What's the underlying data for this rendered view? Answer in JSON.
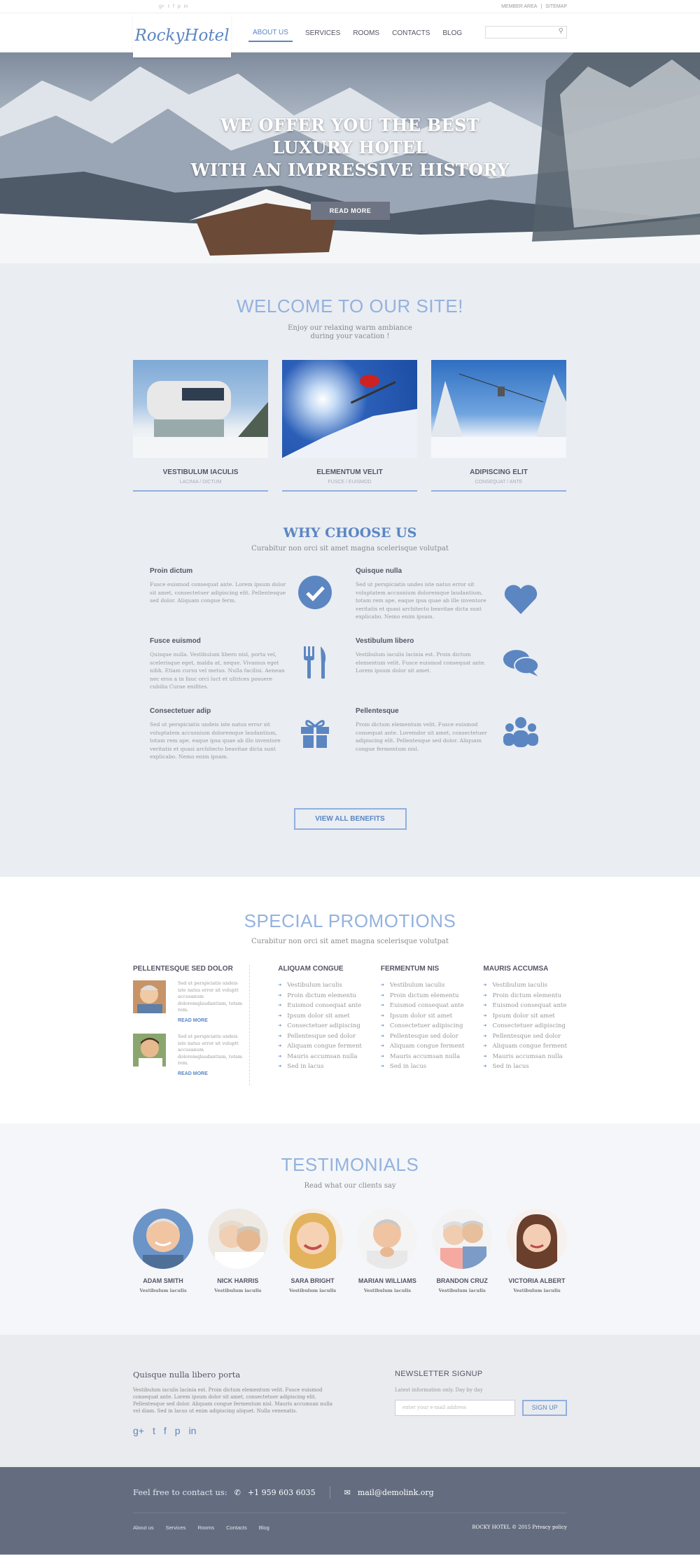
{
  "topbar": {
    "socials": [
      "g+",
      "t",
      "f",
      "p",
      "in"
    ],
    "links": [
      "MEMBER AREA",
      "|",
      "SITEMAP"
    ]
  },
  "header": {
    "logo": "RockyHotel",
    "nav": [
      "ABOUT US",
      "SERVICES",
      "ROOMS",
      "CONTACTS",
      "BLOG"
    ],
    "search_placeholder": "",
    "search_icon": "search-icon"
  },
  "hero": {
    "line1": "WE OFFER YOU THE BEST",
    "line2": "LUXURY HOTEL",
    "line3": "WITH AN IMPRESSIVE HISTORY",
    "button": "READ MORE"
  },
  "welcome": {
    "title": "WELCOME TO OUR SITE!",
    "sub1": "Enjoy our relaxing warm ambiance",
    "sub2": "during your vacation !",
    "cards": [
      {
        "title": "VESTIBULUM IACULIS",
        "sub": "LACINIA / DICTUM"
      },
      {
        "title": "ELEMENTUM VELIT",
        "sub": "FUSCE / EUISMOD"
      },
      {
        "title": "ADIPISCING ELIT",
        "sub": "CONSEQUAT / ANTE"
      }
    ]
  },
  "why": {
    "title": "WHY CHOOSE US",
    "sub": "Curabitur non orci sit amet magna scelerisque volutpat",
    "items": [
      {
        "title": "Proin dictum",
        "text": "Fusce euismod consequat ante. Lorem ipsum dolor sit amet, consectetuer adipiscing elit. Pellentesque sed dolor. Aliquam congue ferm.",
        "icon": "check-icon"
      },
      {
        "title": "Quisque nulla",
        "text": "Sed ut perspiciatis undes iste natus error sit voluptatem accusnium doloremque laudantium, totam rem ape, eaque ipsa quae ab ille inventore veritatis et quasi architecto beavitae dicta sunt explicabo. Nemo enim ipsam.",
        "icon": "heart-icon"
      },
      {
        "title": "Fusce euismod",
        "text": "Quisque nulla. Vestibulum libero nisl, porta vel, scelerisque eget, malda at, neque. Vivamus eget nibh. Etiam cursu vel metus. Nulla facilisi. Aenean nec eros a in fauc orci luct et ultrices posuere cubilia Curae enifites.",
        "icon": "fork-knife-icon"
      },
      {
        "title": "Vestibulum libero",
        "text": "Vestibulum iaculis lacinia est. Proin dictum elementum velit. Fusce euismod consequat ante. Lorem ipsum dolor sit amet.",
        "icon": "chat-bubbles-icon"
      },
      {
        "title": "Consectetuer adip",
        "text": "Sed ut perspiciatis undeis iste natus error sit voluptatem accusnium doloremque laudantium, totam rem ape, eaque ipsa quae ab illo inventore veritatis et quasi architecto beavitae dicta sunt explicabo. Nemo enim ipsam.",
        "icon": "gift-icon"
      },
      {
        "title": "Pellentesque",
        "text": "Proin dictum elementum velit. Fusce euismod consequat ante. Loremdor sit amet, consectetuer adipiscing elit. Pellentesque sed dolor. Aliquam congue fermentum nisl.",
        "icon": "people-icon"
      }
    ],
    "button": "VIEW ALL BENEFITS"
  },
  "promo": {
    "title": "SPECIAL PROMOTIONS",
    "sub": "Curabitur non orci sit amet magna scelerisque volutpat",
    "left_title": "PELLENTESQUE SED DOLOR",
    "left_items": [
      {
        "text": "Sed ut perspiciatis undeis iste natus error sit voluptt accusanum doloremqlaudantium, totam rem.",
        "more": "READ MORE"
      },
      {
        "text": "Sed ut perspiciatis undeis iste natus error sit voluptt accusanum doloremqlaudantium, totam rem.",
        "more": "READ MORE"
      }
    ],
    "lists": [
      {
        "title": "ALIQUAM CONGUE",
        "items": [
          "Vestibulum iaculis",
          "Proin dictum elementu",
          "Euismod consequat ante",
          "Ipsum dolor sit amet",
          "Consectetuer adipiscing",
          "Pellentesque sed dolor",
          "Aliquam congue ferment",
          "Mauris accumsan nulla",
          "Sed in lacus"
        ]
      },
      {
        "title": "FERMENTUM NIS",
        "items": [
          "Vestibulum iaculis",
          "Proin dictum elementu",
          "Euismod consequat ante",
          "Ipsum dolor sit amet",
          "Consectetuer adipiscing",
          "Pellentesque sed dolor",
          "Aliquam congue ferment",
          "Mauris accumsan nulla",
          "Sed in lacus"
        ]
      },
      {
        "title": "MAURIS ACCUMSA",
        "items": [
          "Vestibulum iaculis",
          "Proin dictum elementu",
          "Euismod consequat ante",
          "Ipsum dolor sit amet",
          "Consectetuer adipiscing",
          "Pellentesque sed dolor",
          "Aliquam congue ferment",
          "Mauris accumsan nulla",
          "Sed in lacus"
        ]
      }
    ]
  },
  "testimonials": {
    "title": "TESTIMONIALS",
    "sub": "Read what our clients say",
    "people": [
      {
        "name": "ADAM SMITH",
        "role": "Vestibulum iaculis"
      },
      {
        "name": "NICK HARRIS",
        "role": "Vestibulum iaculis"
      },
      {
        "name": "SARA BRIGHT",
        "role": "Vestibulum iaculis"
      },
      {
        "name": "MARIAN WILLIAMS",
        "role": "Vestibulum iaculis"
      },
      {
        "name": "BRANDON CRUZ",
        "role": "Vestibulum iaculis"
      },
      {
        "name": "VICTORIA ALBERT",
        "role": "Vestibulum iaculis"
      }
    ]
  },
  "footer": {
    "about_title": "Quisque nulla libero porta",
    "about_text": "Vestibulum iaculis lacinia est. Proin dictum elementum velit. Fusce euismod consequat ante. Lorem ipsum dolor sit amet, consectetuer adipiscing elit. Pellentesque sed dolor. Aliquam congue fermentum nisl. Mauris accumsan nulla vel diam. Sed in lacus ut enim adipiscing aliquet. Nulla venenatis.",
    "socials": [
      "g+",
      "t",
      "f",
      "p",
      "in"
    ],
    "news_title": "NEWSLETTER SIGNUP",
    "news_text": "Latest information only. Day by day",
    "news_placeholder": "enter your e-mail address",
    "news_button": "SIGN UP",
    "contact_label": "Feel free to contact us:",
    "phone": "+1 959 603 6035",
    "email": "mail@demolink.org",
    "links": [
      "About us",
      "Services",
      "Rooms",
      "Contacts",
      "Blog"
    ],
    "copyright": "ROCKY HOTEL © 2015 Privacy policy"
  }
}
